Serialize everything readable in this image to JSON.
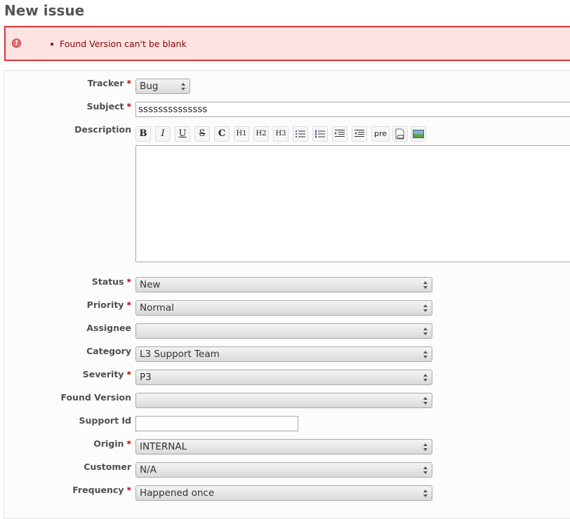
{
  "page": {
    "title": "New issue"
  },
  "errors": {
    "items": [
      "Found Version can't be blank"
    ]
  },
  "form": {
    "required_mark": "*",
    "tracker": {
      "label": "Tracker",
      "value": "Bug"
    },
    "subject": {
      "label": "Subject",
      "value": "ssssssssssssss"
    },
    "description": {
      "label": "Description",
      "toolbar": {
        "bold": "B",
        "italic": "I",
        "underline": "U",
        "strike": "S",
        "code": "C",
        "h1": "H1",
        "h2": "H2",
        "h3": "H3",
        "pre": "pre"
      }
    },
    "status": {
      "label": "Status",
      "value": "New"
    },
    "priority": {
      "label": "Priority",
      "value": "Normal"
    },
    "assignee": {
      "label": "Assignee",
      "value": ""
    },
    "category": {
      "label": "Category",
      "value": "L3 Support Team"
    },
    "severity": {
      "label": "Severity",
      "value": "P3"
    },
    "found_version": {
      "label": "Found Version",
      "value": ""
    },
    "support_id": {
      "label": "Support Id",
      "value": ""
    },
    "origin": {
      "label": "Origin",
      "value": "INTERNAL"
    },
    "customer": {
      "label": "Customer",
      "value": "N/A"
    },
    "frequency": {
      "label": "Frequency",
      "value": "Happened once"
    }
  },
  "colors": {
    "error_border": "#dd3333",
    "error_bg": "#ffe3e3",
    "required": "#bb0000"
  }
}
